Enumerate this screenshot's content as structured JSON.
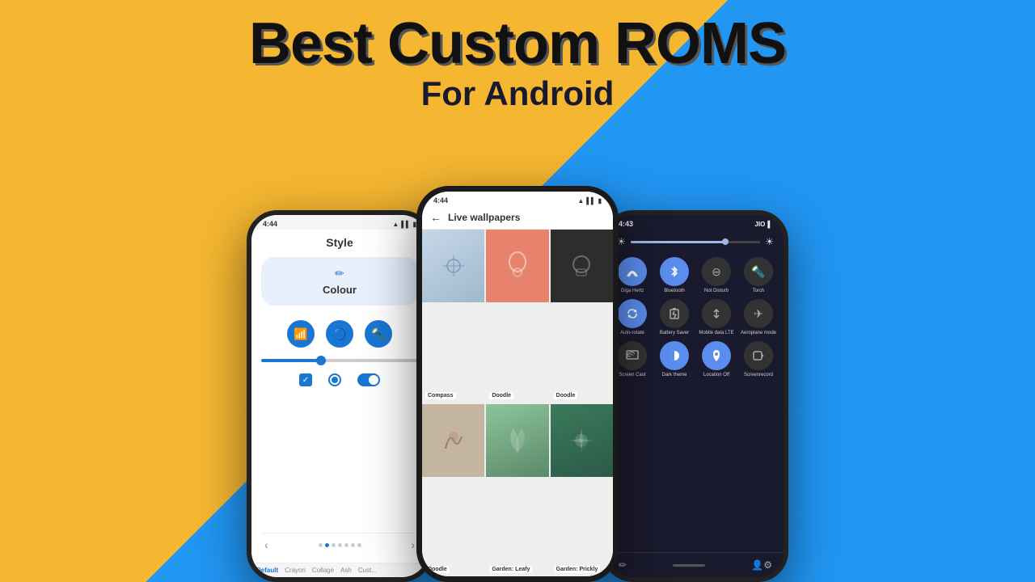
{
  "background": {
    "left_color": "#F5B731",
    "right_color": "#2196F3"
  },
  "title": {
    "main": "Best Custom ROMS",
    "sub": "For Android"
  },
  "phone1": {
    "time": "4:44",
    "screen_title": "Style",
    "colour_label": "Colour",
    "tabs": [
      "Default",
      "Crayon",
      "Collage",
      "Ash",
      "Cust..."
    ],
    "active_tab": "Default"
  },
  "phone2": {
    "time": "4:44",
    "header_title": "Live wallpapers",
    "back_icon": "←",
    "wallpapers": [
      {
        "label": "Compass",
        "type": "compass"
      },
      {
        "label": "Doodle",
        "type": "doodle1"
      },
      {
        "label": "Doodle",
        "type": "doodle2"
      },
      {
        "label": "Doodle",
        "type": "doodle3"
      },
      {
        "label": "Garden: Leafy",
        "type": "garden1"
      },
      {
        "label": "Garden: Prickly",
        "type": "garden2"
      }
    ]
  },
  "phone3": {
    "time": "4:43",
    "carrier": "JIO",
    "quick_settings": [
      {
        "label": "Giga Hertz",
        "icon": "📶",
        "active": true
      },
      {
        "label": "Bluetooth",
        "icon": "🔵",
        "active": true
      },
      {
        "label": "Not Disturb",
        "icon": "⊖",
        "active": false
      },
      {
        "label": "Torch",
        "icon": "🔦",
        "active": false
      },
      {
        "label": "Auto-rotate",
        "icon": "↻",
        "active": true
      },
      {
        "label": "Battery Saver",
        "icon": "🔋",
        "active": false
      },
      {
        "label": "Mobile data LTE",
        "icon": "↑↓",
        "active": false
      },
      {
        "label": "Aeroplane mode",
        "icon": "✈",
        "active": false
      },
      {
        "label": "Screen Cast",
        "icon": "📺",
        "active": false
      },
      {
        "label": "Dark theme",
        "icon": "◑",
        "active": true
      },
      {
        "label": "Location Off",
        "icon": "📍",
        "active": true
      },
      {
        "label": "Screenrecord",
        "icon": "📱",
        "active": false
      }
    ]
  }
}
